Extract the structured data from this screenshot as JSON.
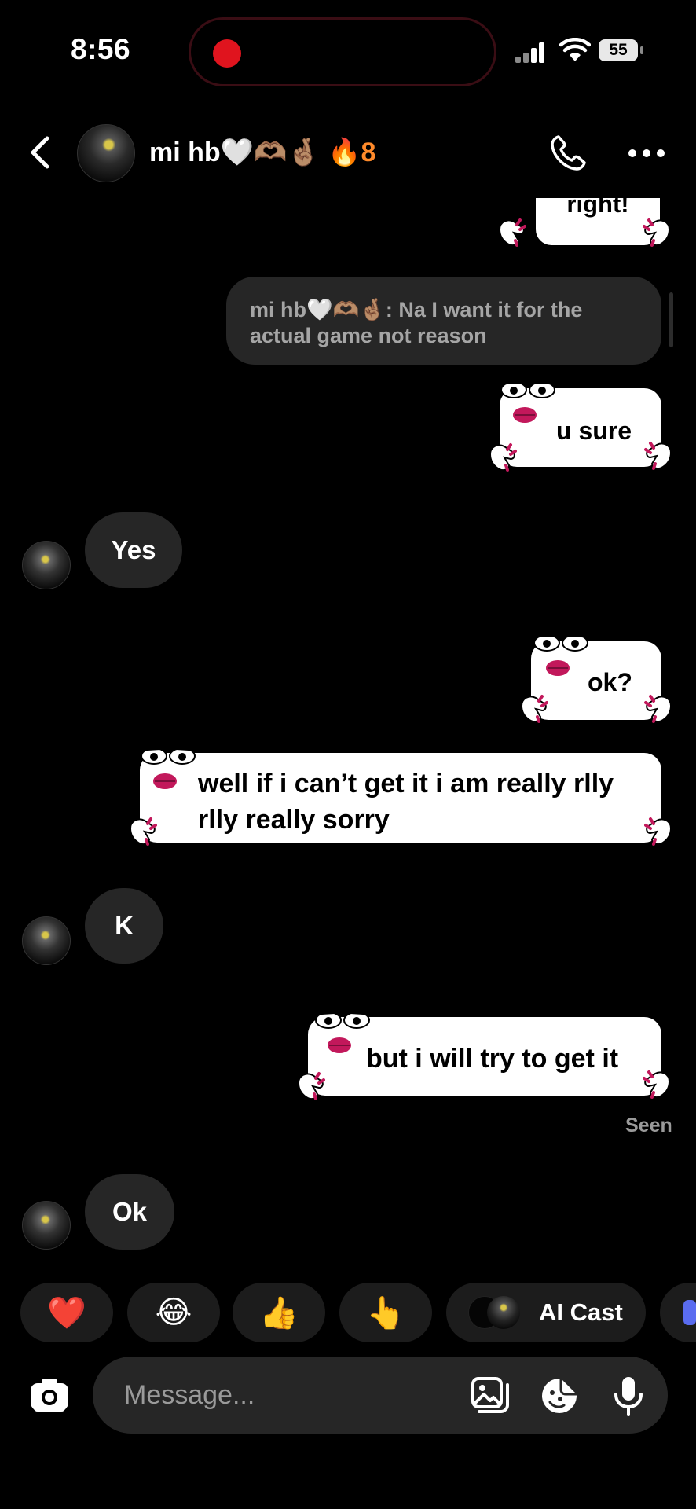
{
  "status": {
    "time": "8:56",
    "battery": "55"
  },
  "header": {
    "name": "mi hb🤍🫶🏽🤞🏽",
    "streak_emoji": "🔥",
    "streak_count": "8"
  },
  "messages": {
    "top_partial": "right!",
    "reply_quote": "mi hb🤍🫶🏽🤞🏽: Na I want it for the actual game not reason",
    "m1": "u sure",
    "m2": "Yes",
    "m3": "ok?",
    "m4": "well if i can’t get it i am really rlly rlly really sorry",
    "m5": "K",
    "m6": "but i will try to get it",
    "seen": "Seen",
    "m7": "Ok"
  },
  "reactions": {
    "r1": "❤️",
    "r2": "😂",
    "r3": "👍",
    "r4": "👆",
    "ai_cast": "AI Cast"
  },
  "composer": {
    "placeholder": "Message..."
  },
  "colors": {
    "record": "#e0141e",
    "streak": "#ff8a2a",
    "bubble_dark": "#262626",
    "sticker_lips": "#c2185b"
  }
}
